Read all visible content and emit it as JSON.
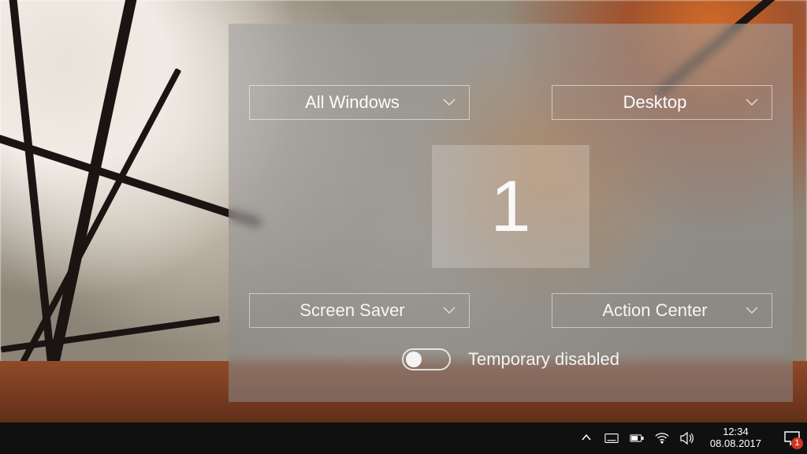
{
  "panel": {
    "corners": {
      "top_left": {
        "label": "All Windows"
      },
      "top_right": {
        "label": "Desktop"
      },
      "bottom_left": {
        "label": "Screen Saver"
      },
      "bottom_right": {
        "label": "Action Center"
      }
    },
    "desktop_tile": "1",
    "toggle": {
      "state": "off",
      "label": "Temporary disabled"
    }
  },
  "taskbar": {
    "time": "12:34",
    "date": "08.08.2017",
    "action_center_badge": "1"
  }
}
